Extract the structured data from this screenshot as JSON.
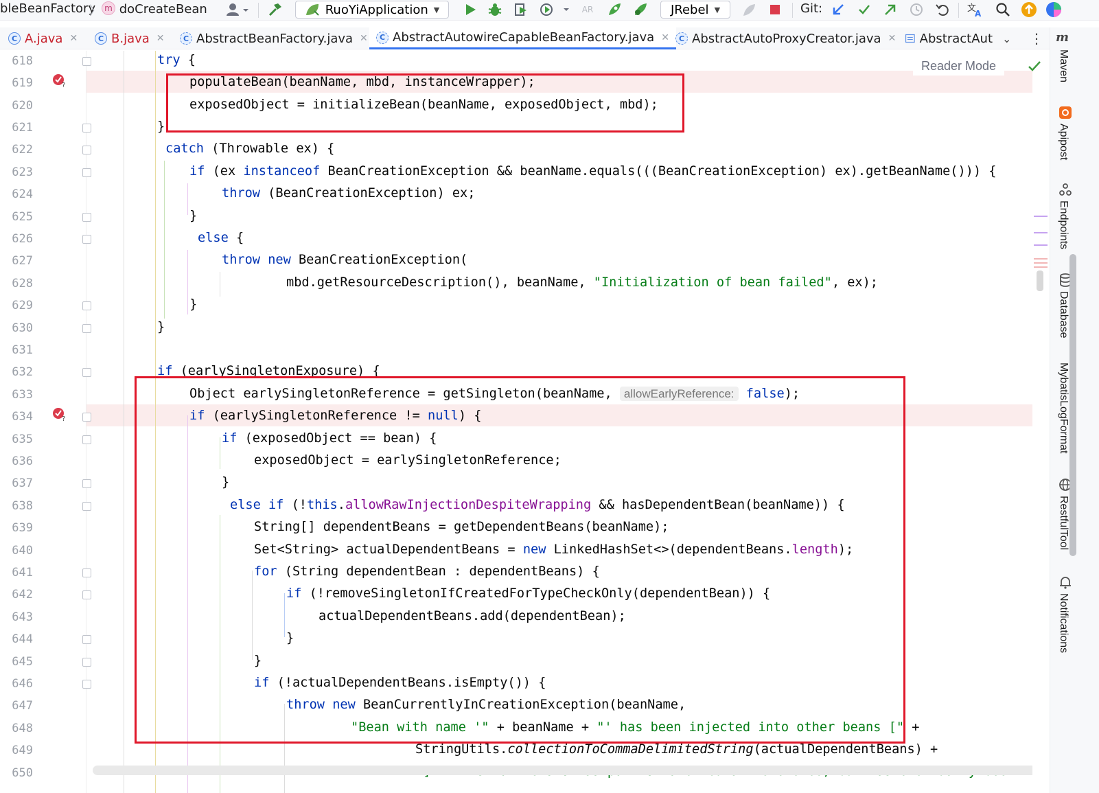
{
  "breadcrumbs": [
    {
      "label": "bleBeanFactory"
    },
    {
      "label": "doCreateBean",
      "badge": "m"
    }
  ],
  "toolbar": {
    "run_config": "RuoYiApplication",
    "jrebel": "JRebel",
    "git_label": "Git:"
  },
  "tabs": [
    {
      "label": "A.java",
      "icon": "C",
      "active": false
    },
    {
      "label": "B.java",
      "icon": "C",
      "active": false
    },
    {
      "label": "AbstractBeanFactory.java",
      "icon": "C",
      "active": false
    },
    {
      "label": "AbstractAutowireCapableBeanFactory.java",
      "icon": "C",
      "active": true
    },
    {
      "label": "AbstractAutoProxyCreator.java",
      "icon": "C",
      "active": false
    },
    {
      "label": "AbstractAut",
      "icon": "E",
      "active": false
    }
  ],
  "editor": {
    "reader_mode": "Reader Mode",
    "line_numbers": [
      "618",
      "619",
      "620",
      "621",
      "622",
      "623",
      "624",
      "625",
      "626",
      "627",
      "628",
      "629",
      "630",
      "631",
      "632",
      "633",
      "634",
      "635",
      "636",
      "637",
      "638",
      "639",
      "640",
      "641",
      "642",
      "643",
      "644",
      "645",
      "646",
      "647",
      "648",
      "649",
      "650"
    ],
    "breakpoint_lines": [
      "619",
      "634"
    ],
    "code": {
      "l618": {
        "a": "try",
        "b": " {"
      },
      "l619": "populateBean(beanName, mbd, instanceWrapper);",
      "l620": "exposedObject = initializeBean(beanName, exposedObject, mbd);",
      "l621": "}",
      "l622": {
        "a": "catch",
        "b": " (Throwable ex) {"
      },
      "l623": {
        "a": "if",
        "b": " (ex ",
        "c": "instanceof",
        "d": " BeanCreationException && beanName.equals(((BeanCreationException) ex).getBeanName())) {"
      },
      "l624": {
        "a": "throw",
        "b": " (BeanCreationException) ex;"
      },
      "l625": "}",
      "l626": {
        "a": "else",
        "b": " {"
      },
      "l627": {
        "a": "throw",
        "b": " ",
        "c": "new",
        "d": " BeanCreationException("
      },
      "l628": {
        "a": "mbd.getResourceDescription(), beanName, ",
        "b": "\"Initialization of bean failed\"",
        "c": ", ex);"
      },
      "l629": "}",
      "l630": "}",
      "l632": {
        "a": "if",
        "b": " (earlySingletonExposure) {"
      },
      "l633": {
        "a": "Object earlySingletonReference = getSingleton(beanName, ",
        "hint": "allowEarlyReference:",
        "c": "false",
        "d": ");"
      },
      "l634": {
        "a": "if",
        "b": " (earlySingletonReference != ",
        "c": "null",
        "d": ") {"
      },
      "l635": {
        "a": "if",
        "b": " (exposedObject == bean) {"
      },
      "l636": "exposedObject = earlySingletonReference;",
      "l637": "}",
      "l638": {
        "a": "else if",
        "b": " (!",
        "c": "this",
        "d": ".",
        "e": "allowRawInjectionDespiteWrapping",
        "f": " && hasDependentBean(beanName)) {"
      },
      "l639": "String[] dependentBeans = getDependentBeans(beanName);",
      "l640": {
        "a": "Set<String> actualDependentBeans = ",
        "b": "new",
        "c": " LinkedHashSet<>(dependentBeans.",
        "d": "length",
        "e": ");"
      },
      "l641": {
        "a": "for",
        "b": " (String dependentBean : dependentBeans) {"
      },
      "l642": {
        "a": "if",
        "b": " (!removeSingletonIfCreatedForTypeCheckOnly(dependentBean)) {"
      },
      "l643": "actualDependentBeans.add(dependentBean);",
      "l644": "}",
      "l645": "}",
      "l646": {
        "a": "if",
        "b": " (!actualDependentBeans.isEmpty()) {"
      },
      "l647": {
        "a": "throw",
        "b": " ",
        "c": "new",
        "d": " BeanCurrentlyInCreationException(beanName,"
      },
      "l648": {
        "a": "\"Bean with name '\"",
        "b": " + beanName + ",
        "c": "\"' has been injected into other beans [\"",
        "d": " +"
      },
      "l649": {
        "a": "StringUtils.",
        "b": "collectionToCommaDelimitedString",
        "c": "(actualDependentBeans) +"
      },
      "l650": {
        "a": "\"] in its raw version as part of a circular reference, but has eventually been"
      }
    }
  },
  "right_panel": [
    "Maven",
    "Apipost",
    "Endpoints",
    "Database",
    "MybatisLogFormat",
    "RestfulTool",
    "Notifications"
  ],
  "colors": {
    "keyword": "#0033b3",
    "string": "#067d17",
    "field": "#871094",
    "highlight_box": "#e0172a",
    "breakpoint": "#db3b4b"
  }
}
